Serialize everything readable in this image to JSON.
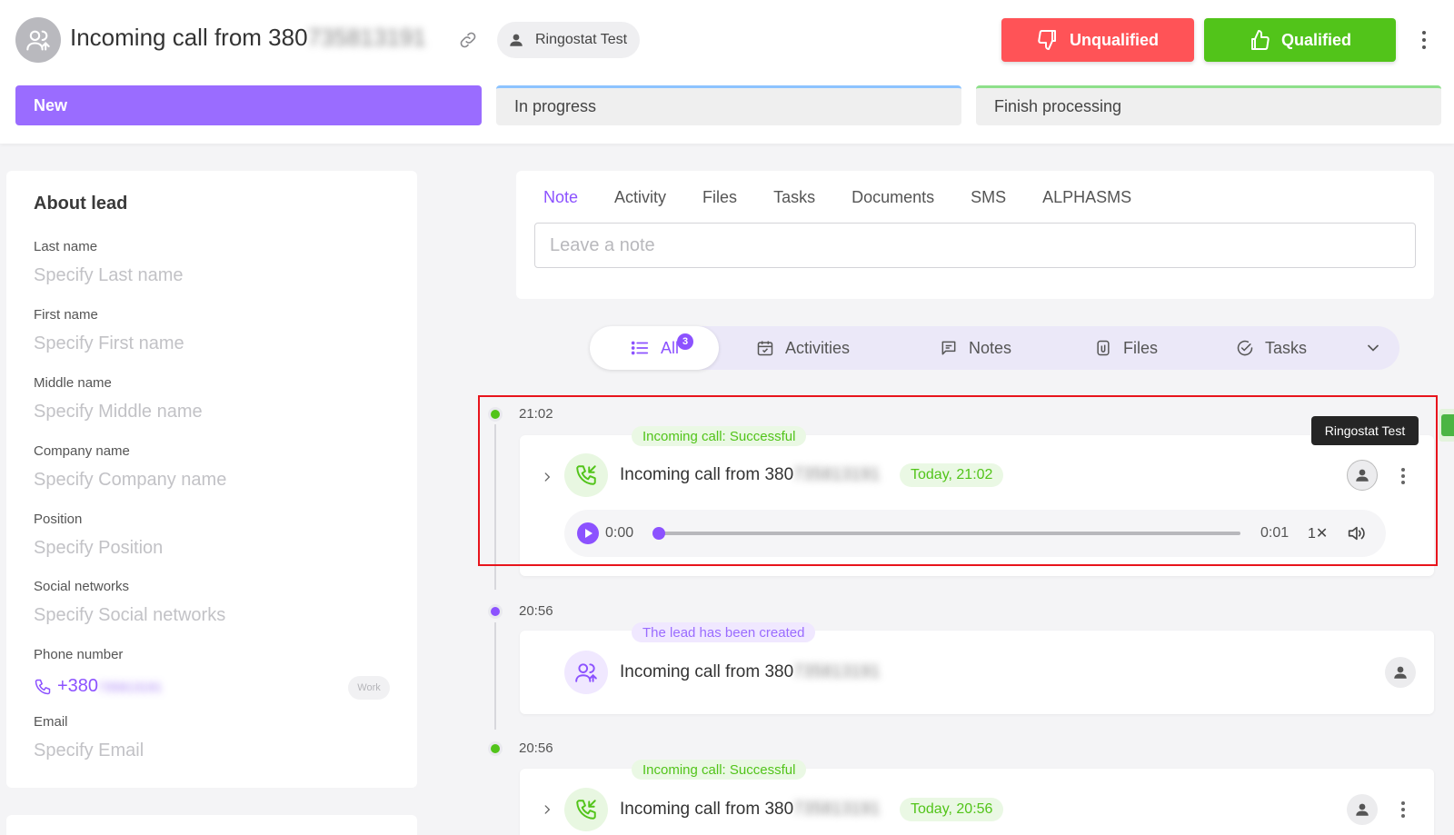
{
  "header": {
    "title_prefix": "Incoming call from 380",
    "title_masked": "735813191",
    "owner": "Ringostat Test",
    "unqualified_label": "Unqualified",
    "qualified_label": "Qualified"
  },
  "stages": [
    {
      "label": "New"
    },
    {
      "label": "In progress"
    },
    {
      "label": "Finish processing"
    }
  ],
  "about": {
    "title": "About lead",
    "fields": [
      {
        "label": "Last name",
        "placeholder": "Specify Last name"
      },
      {
        "label": "First name",
        "placeholder": "Specify First name"
      },
      {
        "label": "Middle name",
        "placeholder": "Specify Middle name"
      },
      {
        "label": "Company name",
        "placeholder": "Specify Company name"
      },
      {
        "label": "Position",
        "placeholder": "Specify Position"
      },
      {
        "label": "Social networks",
        "placeholder": "Specify Social networks"
      },
      {
        "label": "Phone number"
      },
      {
        "label": "Email",
        "placeholder": "Specify Email"
      }
    ],
    "phone_prefix": "+380",
    "phone_masked": "735813191",
    "phone_tag": "Work"
  },
  "composer": {
    "tabs": [
      "Note",
      "Activity",
      "Files",
      "Tasks",
      "Documents",
      "SMS",
      "ALPHASMS"
    ],
    "active_tab": "Note",
    "placeholder": "Leave a note"
  },
  "filters": {
    "all_label": "All",
    "all_count": "3",
    "items": [
      "Activities",
      "Notes",
      "Files",
      "Tasks"
    ]
  },
  "timeline": [
    {
      "time": "21:02",
      "dot_color": "#52c41a",
      "badge": "Incoming call: Successful",
      "title_prefix": "Incoming call from 380",
      "title_masked": "735813191",
      "date_badge": "Today, 21:02",
      "player": {
        "current": "0:00",
        "duration": "0:01",
        "speed": "1✕",
        "progress": 0.0
      }
    },
    {
      "time": "20:56",
      "dot_color": "#8c52ff",
      "badge": "The lead has been created",
      "title_prefix": "Incoming call from 380",
      "title_masked": "735813191"
    },
    {
      "time": "20:56",
      "dot_color": "#52c41a",
      "badge": "Incoming call: Successful",
      "title_prefix": "Incoming call from 380",
      "title_masked": "735813191",
      "date_badge": "Today, 20:56"
    }
  ],
  "tooltip": "Ringostat Test",
  "colors": {
    "accent": "#8c52ff",
    "success": "#52c41a",
    "danger": "#ff5357",
    "highlight_frame": "#e8141c"
  }
}
